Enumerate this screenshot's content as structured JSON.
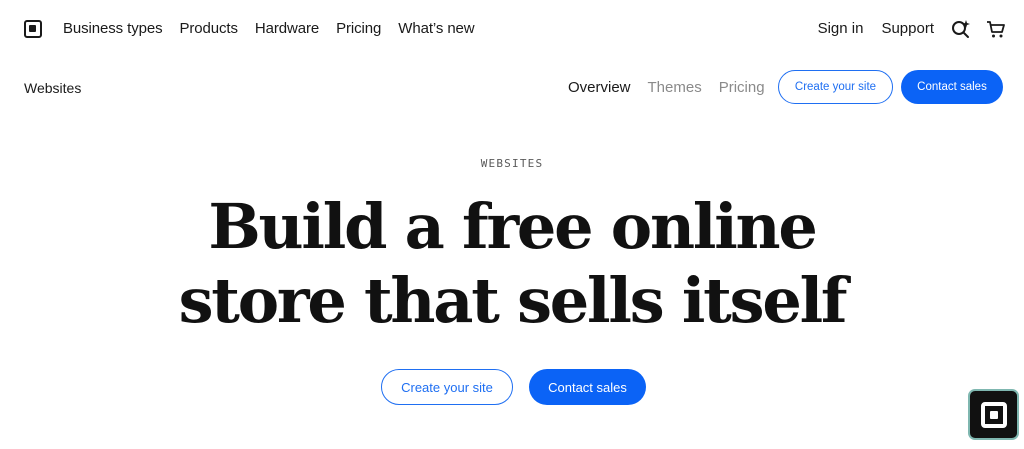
{
  "topnav": {
    "items": [
      "Business types",
      "Products",
      "Hardware",
      "Pricing",
      "What’s new"
    ],
    "sign_in": "Sign in",
    "support": "Support"
  },
  "subnav": {
    "title": "Websites",
    "links": [
      "Overview",
      "Themes",
      "Pricing"
    ],
    "create_site": "Create your site",
    "contact_sales": "Contact sales"
  },
  "hero": {
    "eyebrow": "WEBSITES",
    "headline_line1": "Build a free online",
    "headline_line2": "store that sells itself",
    "create_site": "Create your site",
    "contact_sales": "Contact sales"
  },
  "icons": {
    "logo": "square-logo-icon",
    "search": "search-sparkle-icon",
    "cart": "cart-icon",
    "widget": "square-chat-widget-icon"
  },
  "colors": {
    "accent": "#0b63f6",
    "text": "#1a1a1a",
    "muted": "#8a8a8a"
  }
}
